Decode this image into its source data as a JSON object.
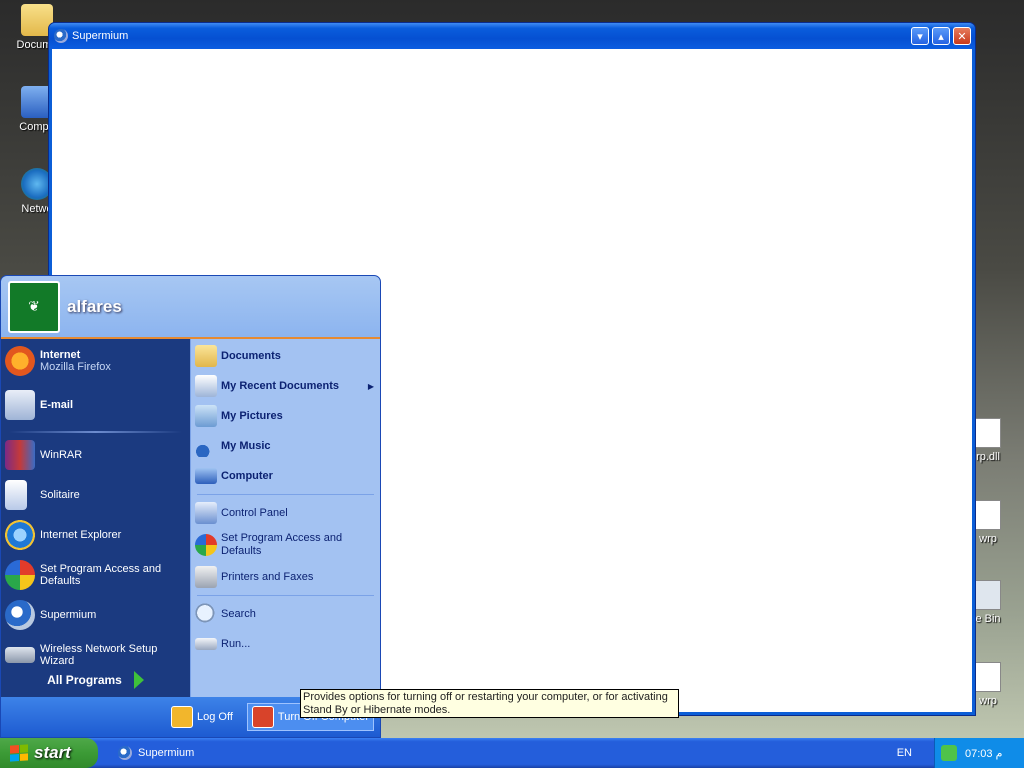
{
  "desktop": {
    "icons": [
      {
        "label": "Docume",
        "icon": "folder-icon"
      },
      {
        "label": "Compu",
        "icon": "computer-icon"
      },
      {
        "label": "Netwo",
        "icon": "network-icon"
      }
    ],
    "right_icons": [
      "rp.dll",
      "wrp",
      "e Bin",
      "wrp"
    ]
  },
  "window": {
    "title": "Supermium",
    "buttons": {
      "minimize": "▾",
      "maximize": "▴",
      "close": "✕"
    }
  },
  "start_menu": {
    "user": "alfares",
    "left": {
      "pinned": [
        {
          "title": "Internet",
          "subtitle": "Mozilla Firefox",
          "icon": "firefox-icon"
        },
        {
          "title": "E-mail",
          "subtitle": "",
          "icon": "email-icon"
        }
      ],
      "recent": [
        {
          "label": "WinRAR",
          "icon": "winrar-icon"
        },
        {
          "label": "Solitaire",
          "icon": "solitaire-icon"
        },
        {
          "label": "Internet Explorer",
          "icon": "internet-explorer-icon"
        },
        {
          "label": "Set Program Access and Defaults",
          "icon": "program-access-icon"
        },
        {
          "label": "Supermium",
          "icon": "supermium-icon"
        },
        {
          "label": "Wireless Network Setup Wizard",
          "icon": "wireless-icon"
        }
      ],
      "all_programs": "All Programs"
    },
    "right": {
      "places": [
        {
          "label": "Documents",
          "icon": "documents-icon",
          "submenu": false
        },
        {
          "label": "My Recent Documents",
          "icon": "recent-docs-icon",
          "submenu": true
        },
        {
          "label": "My Pictures",
          "icon": "pictures-icon",
          "submenu": false
        },
        {
          "label": "My Music",
          "icon": "music-icon",
          "submenu": false
        },
        {
          "label": "Computer",
          "icon": "computer-icon",
          "submenu": false
        }
      ],
      "settings": [
        {
          "label": "Control Panel",
          "icon": "control-panel-icon"
        },
        {
          "label": "Set Program Access and Defaults",
          "icon": "program-access-icon"
        },
        {
          "label": "Printers and Faxes",
          "icon": "printer-icon"
        }
      ],
      "tools": [
        {
          "label": "Search",
          "icon": "search-icon"
        },
        {
          "label": "Run...",
          "icon": "run-icon"
        }
      ]
    },
    "footer": {
      "log_off": "Log Off",
      "turn_off": "Turn Off Computer"
    }
  },
  "tooltip": "Provides options for turning off or restarting your computer, or for activating Stand By or Hibernate modes.",
  "taskbar": {
    "start": "start",
    "tasks": [
      {
        "label": "Supermium"
      }
    ],
    "language": "EN",
    "clock": "07:03 م"
  }
}
